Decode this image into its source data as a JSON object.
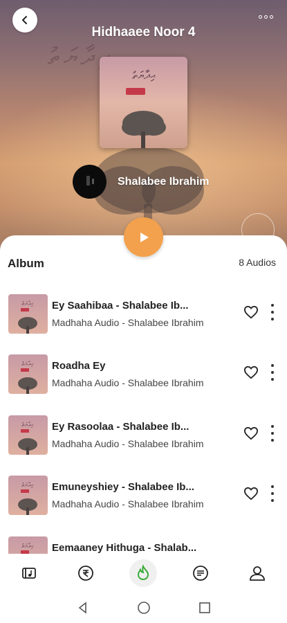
{
  "header": {
    "title": "Hidhaaee Noor 4"
  },
  "artist": {
    "name": "Shalabee Ibrahim"
  },
  "album": {
    "label": "Album",
    "count": "8 Audios"
  },
  "tracks": [
    {
      "title": "Ey Saahibaa - Shalabee Ib...",
      "subtitle": "Madhaha Audio - Shalabee Ibrahim"
    },
    {
      "title": "Roadha Ey",
      "subtitle": "Madhaha Audio - Shalabee Ibrahim"
    },
    {
      "title": "Ey Rasoolaa - Shalabee Ib...",
      "subtitle": "Madhaha Audio - Shalabee Ibrahim"
    },
    {
      "title": "Emuneyshiey - Shalabee Ib...",
      "subtitle": "Madhaha Audio - Shalabee Ibrahim"
    },
    {
      "title": "Eemaaney Hithuga - Shalab...",
      "subtitle": ""
    }
  ],
  "nav": [
    "music-library-icon",
    "rupee-coin-icon",
    "home-flame-icon",
    "playlist-icon",
    "profile-icon"
  ],
  "colors": {
    "accent": "#f3a14d",
    "active_nav": "#3caa3c"
  }
}
